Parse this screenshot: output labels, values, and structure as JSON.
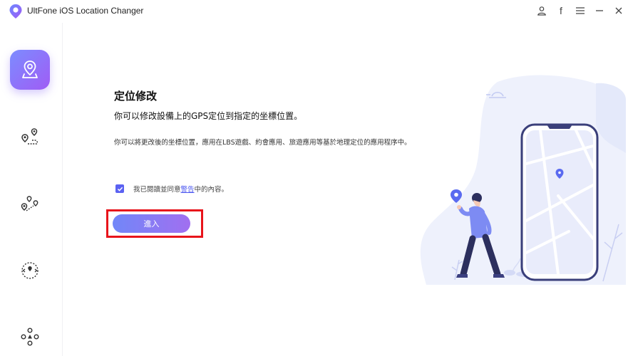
{
  "app": {
    "title": "UltFone iOS Location Changer"
  },
  "titlebar": {
    "icons": [
      "user-icon",
      "facebook-icon",
      "menu-icon",
      "minimize-icon",
      "close-icon"
    ],
    "facebook_glyph": "f"
  },
  "sidebar": {
    "items": [
      {
        "name": "change-location",
        "icon": "map-pin-icon",
        "active": true
      },
      {
        "name": "two-spot-movement",
        "icon": "route-icon",
        "active": false
      },
      {
        "name": "multi-spot-movement",
        "icon": "multi-route-icon",
        "active": false
      },
      {
        "name": "jump-teleport",
        "icon": "teleport-icon",
        "active": false
      },
      {
        "name": "joystick-movement",
        "icon": "joystick-icon",
        "active": false
      }
    ]
  },
  "main": {
    "title": "定位修改",
    "subtitle": "你可以修改設備上的GPS定位到指定的坐標位置。",
    "description": "你可以將更改後的坐標位置，應用在LBS遊戲、約會應用、旅遊應用等基於地理定位的應用程序中。",
    "agree_prefix": "我已閱讀並同意",
    "agree_link": "警告",
    "agree_suffix": "中的內容。",
    "agree_checked": true,
    "enter_label": "進入"
  },
  "colors": {
    "accent": "#5b62f2",
    "button_start": "#7187f8",
    "button_end": "#a16ff0",
    "highlight": "#e8141b"
  }
}
